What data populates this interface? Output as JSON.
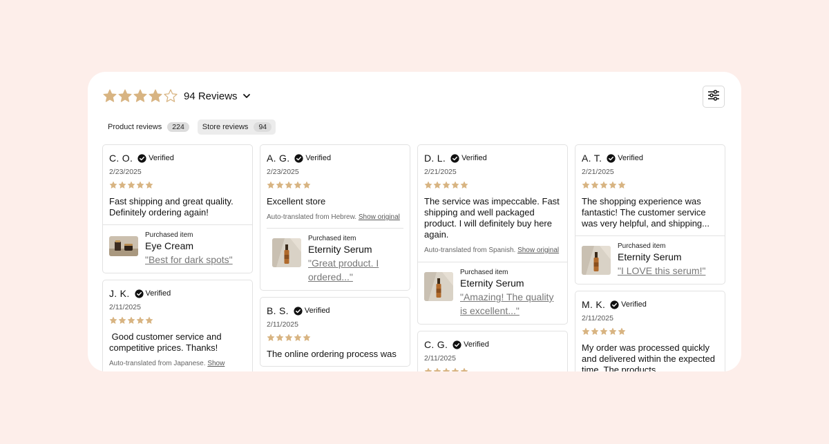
{
  "summary": {
    "rating": 4,
    "max_rating": 5,
    "reviews_label": "94 Reviews",
    "star_color": "#d8b482",
    "icon_dropdown": "chevron-down-icon",
    "icon_filter": "sliders-icon"
  },
  "tabs": [
    {
      "label": "Product reviews",
      "count": "224",
      "active": false
    },
    {
      "label": "Store reviews",
      "count": "94",
      "active": true
    }
  ],
  "verified_label": "Verified",
  "reviews": [
    {
      "name": "C. O.",
      "date": "2/23/2025",
      "rating": 5,
      "text": "Fast shipping and great quality. Definitely ordering again!",
      "purchase": {
        "label": "Purchased item",
        "product": "Eye Cream",
        "quote": "\"Best for dark spots\""
      }
    },
    {
      "name": "J. K.",
      "date": "2/11/2025",
      "rating": 5,
      "text": " Good customer service and competitive prices. Thanks!",
      "translated": "Auto-translated from Japanese.",
      "show_original": "Show"
    },
    {
      "name": "A. G.",
      "date": "2/23/2025",
      "rating": 5,
      "text": "Excellent store",
      "translated": "Auto-translated from Hebrew.",
      "show_original": "Show original",
      "purchase": {
        "label": "Purchased item",
        "product": "Eternity Serum",
        "quote": "\"Great product. I ordered...\""
      }
    },
    {
      "name": "B. S.",
      "date": "2/11/2025",
      "rating": 5,
      "text": "The online ordering process was"
    },
    {
      "name": "D. L.",
      "date": "2/21/2025",
      "rating": 5,
      "text": "The service was impeccable. Fast shipping and well packaged product. I will definitely buy here again.",
      "translated": "Auto-translated from Spanish.",
      "show_original": "Show original",
      "purchase": {
        "label": "Purchased item",
        "product": "Eternity Serum",
        "quote": "\"Amazing! The quality is excellent...\""
      }
    },
    {
      "name": "C. G.",
      "date": "2/11/2025",
      "rating": 5
    },
    {
      "name": "A. T.",
      "date": "2/21/2025",
      "rating": 5,
      "text": "The shopping experience was fantastic! The customer service was very helpful, and shipping...",
      "purchase": {
        "label": "Purchased item",
        "product": "Eternity Serum",
        "quote": "\"I LOVE this serum!\""
      }
    },
    {
      "name": "M. K.",
      "date": "2/11/2025",
      "rating": 5,
      "text": "My order was processed quickly and delivered within the expected time. The products"
    }
  ]
}
